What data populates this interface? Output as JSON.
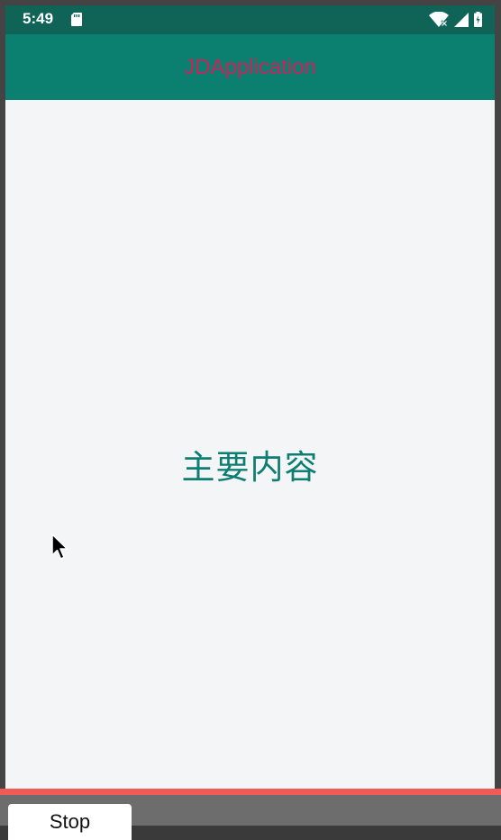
{
  "status_bar": {
    "time": "5:49",
    "icons": [
      "sd-card-icon",
      "wifi-icon",
      "cell-signal-icon",
      "battery-icon"
    ]
  },
  "app_bar": {
    "title": "JDApplication",
    "title_color": "#c7245c",
    "background": "#0c8070"
  },
  "main": {
    "text": "主要内容",
    "text_color": "#0e7d72"
  },
  "recorder": {
    "stop_label": "Stop"
  }
}
